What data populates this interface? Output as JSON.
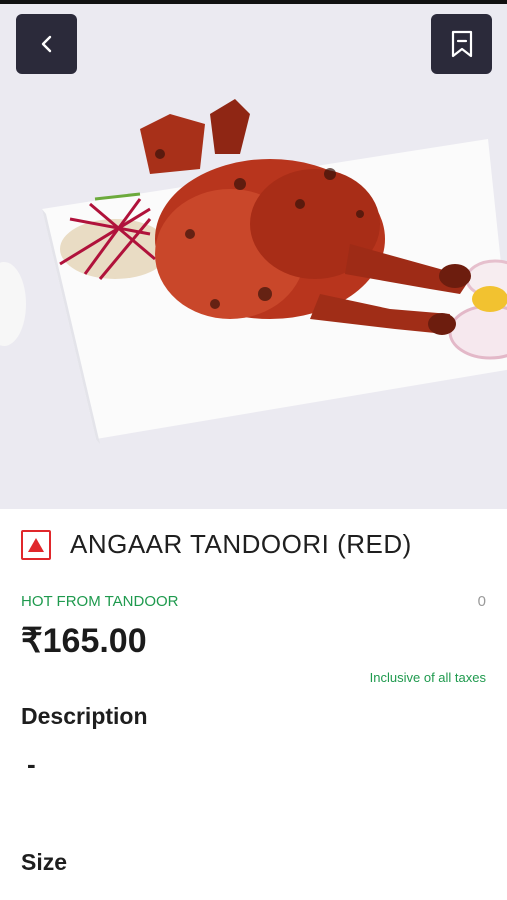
{
  "header": {
    "back_icon": "chevron-left-icon",
    "bookmark_icon": "bookmark-icon"
  },
  "hero": {
    "image": "tandoori-chicken-photo"
  },
  "item": {
    "title": "ANGAAR TANDOORI (RED)",
    "category": "HOT FROM TANDOOR",
    "count": "0",
    "price": "₹165.00",
    "tax_note": "Inclusive of all taxes",
    "type_marker_color": "#e0272b"
  },
  "sections": {
    "description_heading": "Description",
    "description_value": "-",
    "size_heading": "Size"
  }
}
